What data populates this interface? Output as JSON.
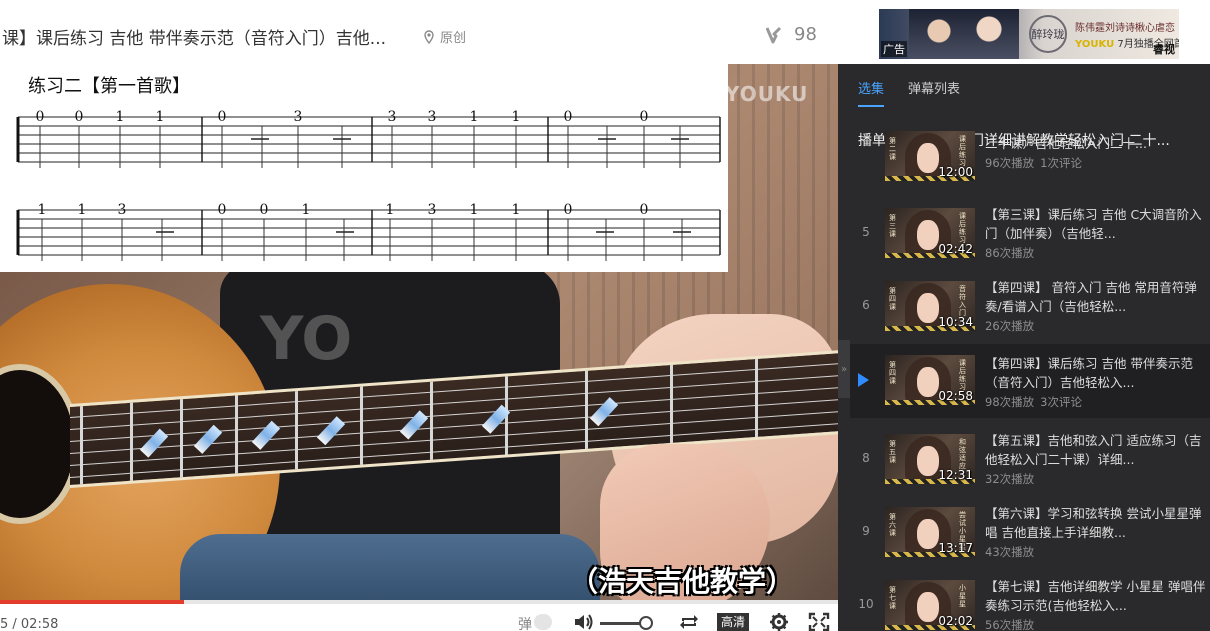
{
  "header": {
    "title": "课】课后练习 吉他 带伴奏示范（音符入门）吉他...",
    "original_label": "原创",
    "like_count": "98"
  },
  "ad": {
    "line1": "陈伟霆刘诗诗楸心虐恋",
    "brand_inline": "YOUKU",
    "line2": "7月独播全网首播",
    "tag": "广告",
    "brand": "睿视"
  },
  "video": {
    "watermark": "YOUKU",
    "caption": "（浩天吉他教学）",
    "tab_title": "练习二【第一首歌】",
    "tab_row1": [
      "0",
      "0",
      "1",
      "1",
      "0",
      "3",
      "3",
      "3",
      "1",
      "1",
      "0",
      "0"
    ],
    "tab_row2": [
      "1",
      "1",
      "3",
      "0",
      "0",
      "1",
      "1",
      "3",
      "1",
      "1",
      "0",
      "0"
    ]
  },
  "controls": {
    "time": "5 / 02:58",
    "progress_fraction": 0.22,
    "danmu_label": "弹",
    "quality_label": "高清",
    "volume_fraction": 0.88
  },
  "sidebar": {
    "tabs": [
      {
        "label": "选集",
        "active": true
      },
      {
        "label": "弹幕列表",
        "active": false
      }
    ],
    "playlist_title": "播单：民谣吉他入门详细讲解教学轻松入门 二十...",
    "items": [
      {
        "num": "",
        "title": "二十课）吉他轻松入门二十...",
        "duration": "12:00",
        "views": "96次播放",
        "comments": "1次评论",
        "thumb_left": "第二课",
        "thumb_right": "课后练习",
        "active": false
      },
      {
        "num": "5",
        "title": "【第三课】课后练习 吉他 C大调音阶入门（加伴奏）（吉他轻...",
        "duration": "02:42",
        "views": "86次播放",
        "comments": "",
        "thumb_left": "第三课",
        "thumb_right": "课后练习",
        "active": false
      },
      {
        "num": "6",
        "title": "【第四课】 音符入门 吉他 常用音符弹奏/看谱入门（吉他轻松...",
        "duration": "10:34",
        "views": "26次播放",
        "comments": "",
        "thumb_left": "第四课",
        "thumb_right": "音符入门",
        "active": false
      },
      {
        "num": "",
        "title": "【第四课】课后练习 吉他 带伴奏示范（音符入门）吉他轻松入...",
        "duration": "02:58",
        "views": "98次播放",
        "comments": "3次评论",
        "thumb_left": "第四课",
        "thumb_right": "课后练习",
        "active": true
      },
      {
        "num": "8",
        "title": "【第五课】吉他和弦入门 适应练习（吉他轻松入门二十课）详细...",
        "duration": "12:31",
        "views": "32次播放",
        "comments": "",
        "thumb_left": "第五课",
        "thumb_right": "和弦适应",
        "active": false
      },
      {
        "num": "9",
        "title": "【第六课】学习和弦转换 尝试小星星弹唱 吉他直接上手详细教...",
        "duration": "13:17",
        "views": "43次播放",
        "comments": "",
        "thumb_left": "第六课",
        "thumb_right": "尝试小星星",
        "active": false
      },
      {
        "num": "10",
        "title": "【第七课】吉他详细教学 小星星 弹唱伴奏练习示范(吉他轻松入...",
        "duration": "02:02",
        "views": "56次播放",
        "comments": "",
        "thumb_left": "第七课",
        "thumb_right": "小星星",
        "active": false
      }
    ]
  },
  "colors": {
    "accent_blue": "#4aa3ff",
    "progress_red": "#e23c2c",
    "sidebar_bg": "#2a2a2c"
  }
}
